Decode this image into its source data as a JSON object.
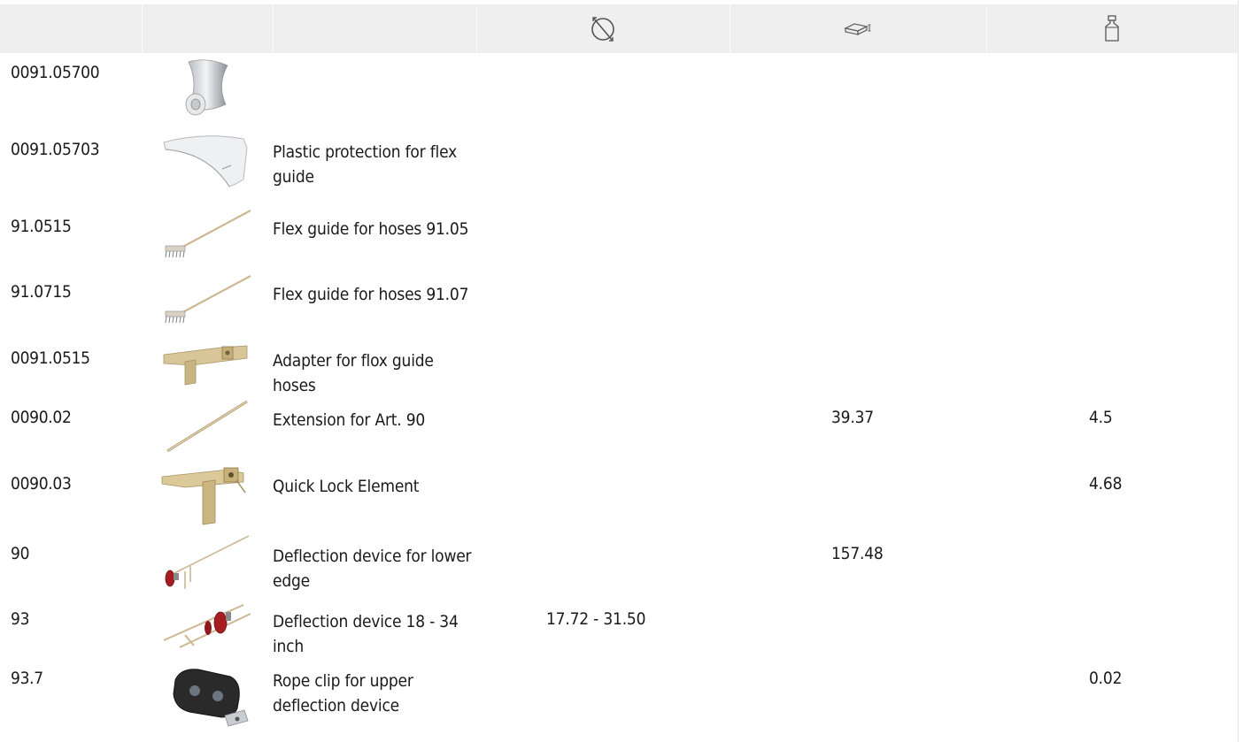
{
  "header": {
    "icons": [
      "diameter-icon",
      "length-icon",
      "weight-icon"
    ]
  },
  "rows": [
    {
      "art": "0091.05700",
      "desc": "",
      "diameter": "",
      "length": "",
      "weight": "",
      "image": "roller-image"
    },
    {
      "art": "0091.05703",
      "desc": "Plastic protection for flex guide",
      "diameter": "",
      "length": "",
      "weight": "",
      "image": "plastic-protection-image"
    },
    {
      "art": "91.0515",
      "desc": "Flex guide for hoses 91.05",
      "diameter": "",
      "length": "",
      "weight": "",
      "image": "flex-guide-image"
    },
    {
      "art": "91.0715",
      "desc": "Flex guide for hoses 91.07",
      "diameter": "",
      "length": "",
      "weight": "",
      "image": "flex-guide-image"
    },
    {
      "art": "0091.0515",
      "desc": "Adapter for flox guide hoses",
      "diameter": "",
      "length": "",
      "weight": "",
      "image": "adapter-image"
    },
    {
      "art": "0090.02",
      "desc": "Extension for Art. 90",
      "diameter": "",
      "length": "39.37",
      "weight": "4.5",
      "image": "extension-rod-image"
    },
    {
      "art": "0090.03",
      "desc": "Quick Lock Element",
      "diameter": "",
      "length": "",
      "weight": "4.68",
      "image": "quick-lock-image"
    },
    {
      "art": "90",
      "desc": "Deflection device for lower edge",
      "diameter": "",
      "length": "157.48",
      "weight": "",
      "image": "deflection-device-image"
    },
    {
      "art": "93",
      "desc": "Deflection device 18 - 34 inch",
      "diameter": "17.72 - 31.50",
      "length": "",
      "weight": "",
      "image": "deflection-device-93-image"
    },
    {
      "art": "93.7",
      "desc": "Rope clip for upper deflection device",
      "diameter": "",
      "length": "",
      "weight": "0.02",
      "image": "rope-clip-image"
    }
  ]
}
